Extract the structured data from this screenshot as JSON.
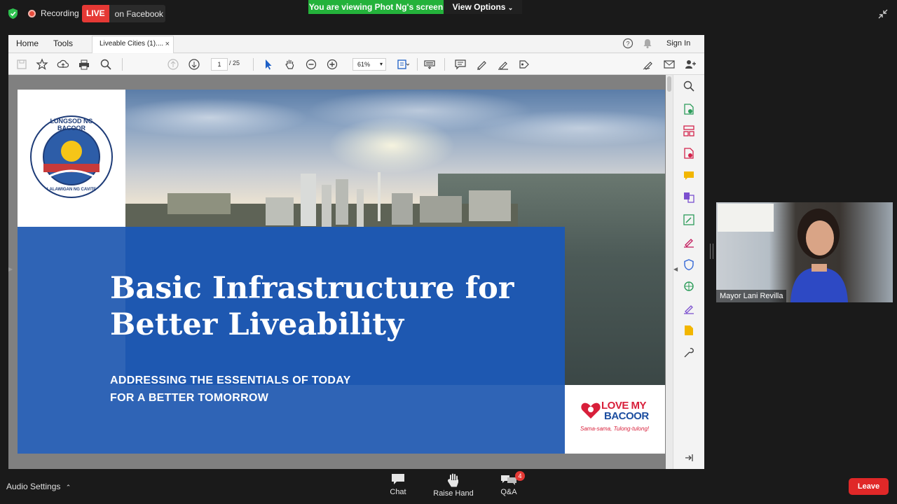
{
  "meeting": {
    "recording_label": "Recording",
    "live_badge": "LIVE",
    "live_platform": "on Facebook",
    "sharing_banner": "You are viewing Phot Ng's screen",
    "view_options": "View Options"
  },
  "acrobat": {
    "menu": {
      "home": "Home",
      "tools": "Tools"
    },
    "doc_tab": "Liveable Cities (1)....",
    "doc_tab_close": "×",
    "sign_in": "Sign In",
    "page_current": "1",
    "page_total": "/ 25",
    "zoom": "61%"
  },
  "slide": {
    "logo_top": "LUNGSOD NG BACOOR",
    "logo_bottom": "LALAWIGAN NG CAVITE",
    "title_line1": "Basic Infrastructure for",
    "title_line2": "Better Liveability",
    "subtitle_line1": "ADDRESSING THE ESSENTIALS OF TODAY",
    "subtitle_line2": "FOR A BETTER TOMORROW",
    "brand_line1": "LOVE MY",
    "brand_line2": "BACOOR",
    "brand_tagline": "Sama-sama, Tulong-tulong!"
  },
  "video": {
    "participant_name": "Mayor Lani Revilla"
  },
  "controls": {
    "audio_settings": "Audio Settings",
    "chat": "Chat",
    "raise_hand": "Raise Hand",
    "qa": "Q&A",
    "qa_count": "4",
    "leave": "Leave"
  },
  "colors": {
    "live_red": "#e53935",
    "share_green": "#24b23b",
    "slide_blue": "#2f64b6",
    "leave_red": "#e02828"
  }
}
